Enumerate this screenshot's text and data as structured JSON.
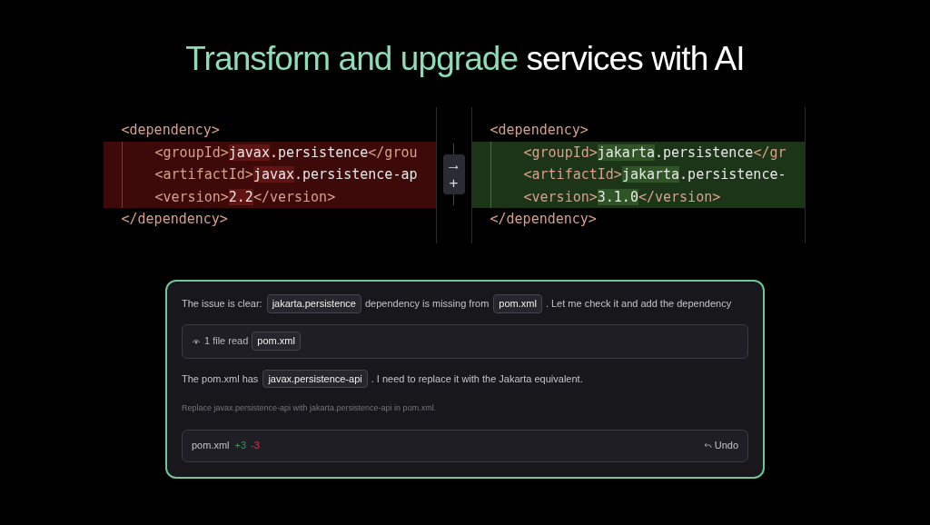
{
  "headline": {
    "accent": "Transform and upgrade",
    "rest": "services with AI"
  },
  "diff": {
    "panels": [
      {
        "kind": "removed",
        "open": "<dependency>",
        "close": "</dependency>",
        "children": [
          {
            "tokens": [
              {
                "kind": "tag",
                "text": "<groupId>"
              },
              {
                "kind": "value",
                "text": "javax",
                "changed": true
              },
              {
                "kind": "value",
                "text": ".persistence",
                "changed": false
              },
              {
                "kind": "tag",
                "text": "</grou"
              }
            ]
          },
          {
            "tokens": [
              {
                "kind": "tag",
                "text": "<artifactId>"
              },
              {
                "kind": "value",
                "text": "javax",
                "changed": true
              },
              {
                "kind": "value",
                "text": ".persistence-ap",
                "changed": false
              }
            ]
          },
          {
            "tokens": [
              {
                "kind": "tag",
                "text": "<version>"
              },
              {
                "kind": "value",
                "text": "2.2",
                "changed": true
              },
              {
                "kind": "tag",
                "text": "</version>"
              }
            ]
          }
        ]
      },
      {
        "kind": "added",
        "open": "<dependency>",
        "close": "</dependency>",
        "children": [
          {
            "tokens": [
              {
                "kind": "tag",
                "text": "<groupId>"
              },
              {
                "kind": "value",
                "text": "jakarta",
                "changed": true
              },
              {
                "kind": "value",
                "text": ".persistence",
                "changed": false
              },
              {
                "kind": "tag",
                "text": "</gr"
              }
            ]
          },
          {
            "tokens": [
              {
                "kind": "tag",
                "text": "<artifactId>"
              },
              {
                "kind": "value",
                "text": "jakarta",
                "changed": true
              },
              {
                "kind": "value",
                "text": ".persistence-",
                "changed": false
              }
            ]
          },
          {
            "tokens": [
              {
                "kind": "tag",
                "text": "<version>"
              },
              {
                "kind": "value",
                "text": "3.1.0",
                "changed": true
              },
              {
                "kind": "tag",
                "text": "</version>"
              }
            ]
          }
        ]
      }
    ],
    "controls": [
      "→",
      "+"
    ]
  },
  "chat": {
    "messages": [
      {
        "kind": "text",
        "parts": [
          {
            "kind": "text",
            "text": "The issue is clear:"
          },
          {
            "kind": "chip",
            "text": "jakarta.persistence"
          },
          {
            "kind": "text",
            "text": "dependency is missing from"
          },
          {
            "kind": "chip",
            "text": "pom.xml"
          },
          {
            "kind": "text",
            "text": ". Let me check it and add the dependency"
          }
        ]
      },
      {
        "kind": "tool",
        "label": "1 file read",
        "file": "pom.xml"
      },
      {
        "kind": "text",
        "parts": [
          {
            "kind": "text",
            "text": "The pom.xml has"
          },
          {
            "kind": "chip",
            "text": "javax.persistence-api"
          },
          {
            "kind": "text",
            "text": ". I need to replace it with the Jakarta equivalent."
          }
        ]
      },
      {
        "kind": "note",
        "text": "Replace javax.persistence-api with jakarta.persistence-api in pom.xml."
      },
      {
        "kind": "change",
        "file": "pom.xml",
        "stats": [
          {
            "kind": "added",
            "text": "+3"
          },
          {
            "kind": "removed",
            "text": "-3"
          }
        ],
        "action": "Undo"
      }
    ]
  }
}
